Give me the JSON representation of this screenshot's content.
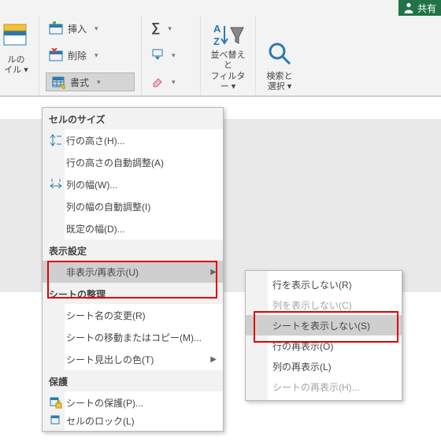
{
  "topbar": {
    "share_label": "共有"
  },
  "ribbon": {
    "cells_group": "ルの\nイル ▾",
    "insert": "挿入",
    "delete": "削除",
    "format": "書式",
    "sort_filter": "並べ替えと\nフィルター ▾",
    "find_select": "検索と\n選択 ▾"
  },
  "menu": {
    "sec_size": "セルのサイズ",
    "row_height": "行の高さ(H)...",
    "row_autofit": "行の高さの自動調整(A)",
    "col_width": "列の幅(W)...",
    "col_autofit": "列の幅の自動調整(I)",
    "default_width": "既定の幅(D)...",
    "sec_visibility": "表示設定",
    "hide_unhide": "非表示/再表示(U)",
    "sec_organize": "シートの整理",
    "rename": "シート名の変更(R)",
    "move_copy": "シートの移動またはコピー(M)...",
    "tab_color": "シート見出しの色(T)",
    "sec_protect": "保護",
    "protect_sheet": "シートの保護(P)...",
    "lock_cell": "セルのロック(L)"
  },
  "submenu": {
    "hide_rows": "行を表示しない(R)",
    "hide_cols": "列を表示しない(C)",
    "hide_sheet": "シートを表示しない(S)",
    "unhide_rows": "行の再表示(O)",
    "unhide_cols": "列の再表示(L)",
    "unhide_sheet": "シートの再表示(H)..."
  }
}
